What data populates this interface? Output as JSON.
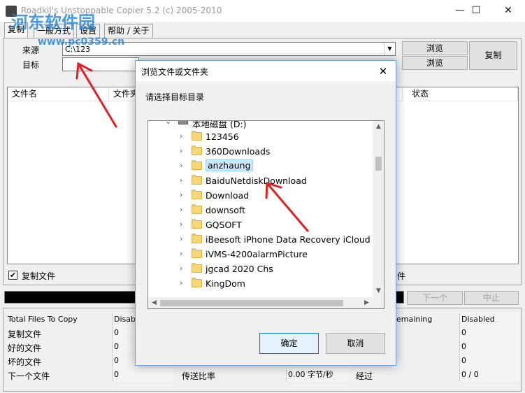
{
  "window": {
    "title": "Roadkil's Unstoppable Copier 5.2 (c) 2005-2010",
    "minimize": "—",
    "maximize": "☐",
    "close": "✕"
  },
  "watermark": {
    "line1": "河东软件园",
    "line2": "www.pc0359.cn",
    "color": "#1e7fd6"
  },
  "tabs": [
    "复制",
    "一般方式",
    "设置",
    "帮助 / 关于"
  ],
  "source": {
    "label": "来源",
    "value": "C:\\123",
    "browse": "浏览"
  },
  "target": {
    "label": "目标",
    "value": "",
    "browse": "浏览"
  },
  "copy_button": "复制",
  "list_columns": [
    "文件名",
    "文件夹",
    "状态"
  ],
  "copy_files_checkbox": {
    "label": "复制文件",
    "checked": "✔"
  },
  "right_partial_text": "件",
  "next_button": "下一个",
  "stop_button": "中止",
  "stats": {
    "rows": [
      {
        "label": "Total Files To Copy",
        "value": "Disable"
      },
      {
        "label": "复制文件",
        "value": "0"
      },
      {
        "label": "好的文件",
        "value": "0"
      },
      {
        "label": "坏的文件",
        "value": "0"
      },
      {
        "label": "下一个文件",
        "value": "0"
      }
    ],
    "transfer_label": "传送比率",
    "transfer_value": "0.00 字节/秒",
    "elapsed_label": "经过",
    "remaining_label": "emaining",
    "right_values": [
      "Disabled",
      "0",
      "0",
      "0",
      "0 / 0"
    ]
  },
  "dialog": {
    "title": "浏览文件或文件夹",
    "close": "✕",
    "prompt": "请选择目标目录",
    "drive": "本地磁盘 (D:)",
    "folders": [
      "123456",
      "360Downloads",
      "anzhaung",
      "BaiduNetdiskDownload",
      "Download",
      "downsoft",
      "GQSOFT",
      "iBeesoft iPhone Data Recovery iCloud Ba",
      "iVMS-4200alarmPicture",
      "jgcad 2020 Chs",
      "KingDom"
    ],
    "selected_folder": "anzhaung",
    "ok": "确定",
    "cancel": "取消"
  },
  "annotation_color": "#e02020"
}
